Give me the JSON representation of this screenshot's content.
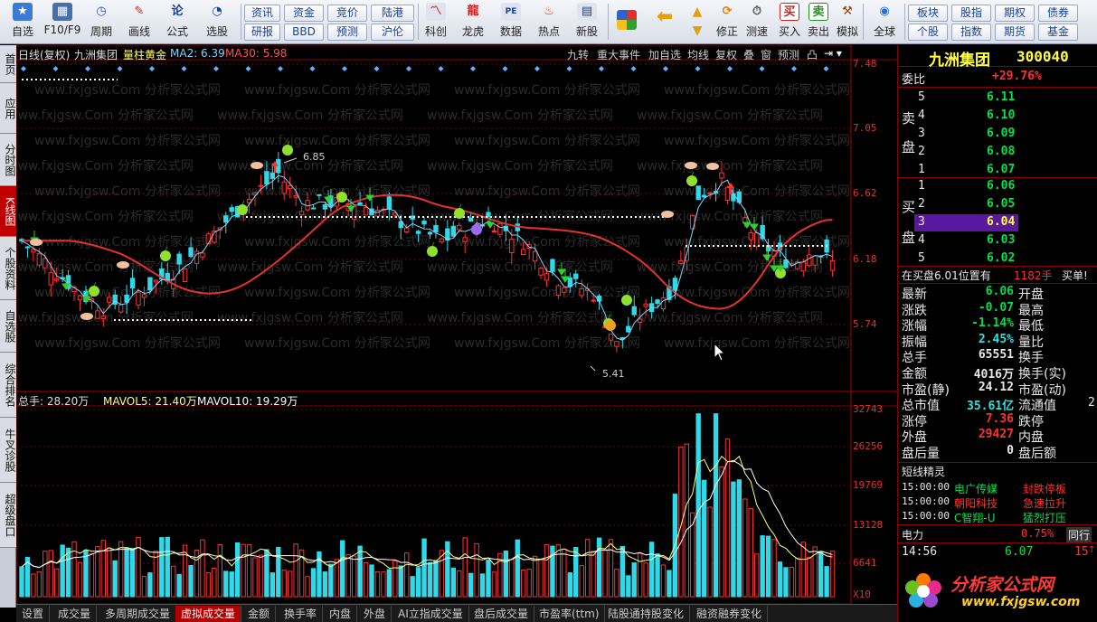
{
  "toolbar": {
    "buttons": [
      {
        "label": "自选",
        "icon": "star"
      },
      {
        "label": "F10/F9",
        "icon": "grid"
      },
      {
        "label": "周期",
        "icon": "clock"
      },
      {
        "label": "画线",
        "icon": "pencil"
      },
      {
        "label": "公式",
        "icon": "formula"
      },
      {
        "label": "选股",
        "icon": "chart"
      }
    ],
    "small_buttons": [
      {
        "label": "资讯"
      },
      {
        "label": "资金"
      },
      {
        "label": "竞价"
      },
      {
        "label": "陆港"
      },
      {
        "label": "研报"
      },
      {
        "label": "BBD"
      },
      {
        "label": "预测"
      },
      {
        "label": "沪伦"
      }
    ],
    "mid_buttons": [
      {
        "label": "科创"
      },
      {
        "label": "龙虎"
      },
      {
        "label": "数据"
      },
      {
        "label": "热点"
      },
      {
        "label": "新股"
      }
    ],
    "action_buttons": [
      {
        "label": "修正"
      },
      {
        "label": "测速"
      },
      {
        "label": "买入"
      },
      {
        "label": "卖出"
      },
      {
        "label": "模拟"
      },
      {
        "label": "全球"
      }
    ],
    "right_buttons": [
      {
        "label": "板块"
      },
      {
        "label": "股指"
      },
      {
        "label": "期权"
      },
      {
        "label": "债券"
      },
      {
        "label": "个股"
      },
      {
        "label": "指数"
      },
      {
        "label": "期货"
      },
      {
        "label": "基金"
      }
    ]
  },
  "left_tabs": [
    {
      "label": "首页"
    },
    {
      "label": "应用"
    },
    {
      "label": "分时图"
    },
    {
      "label": "K线图"
    },
    {
      "label": "个股资料"
    },
    {
      "label": "自选股"
    },
    {
      "label": "综合排名"
    },
    {
      "label": "牛叉诊股"
    },
    {
      "label": "超级盘口"
    }
  ],
  "chart_header": {
    "period": "日线(复权)",
    "stock": "九洲集团",
    "indicator": "量柱黄金",
    "ma2": "MA2: 6.39",
    "ma30": "MA30: 5.98",
    "menu": [
      "九转",
      "重大事件",
      "加自选",
      "均线",
      "复权",
      "叠",
      "窗",
      "预测",
      "凸"
    ],
    "watermark": "www.fxjgsw.Com 分析家公式网"
  },
  "price_axis": [
    "7.48",
    "7.05",
    "6.62",
    "6.18",
    "5.74"
  ],
  "high_label": "6.85",
  "low_label": "5.41",
  "volume_header": {
    "total": "总手: 28.20万",
    "mavol5": "MAVOL5: 21.40万",
    "mavol10": "MAVOL10: 19.29万"
  },
  "volume_axis": [
    "32743",
    "26256",
    "19769",
    "13128",
    "6641",
    "X10"
  ],
  "bottom_tabs": [
    {
      "label": "设置"
    },
    {
      "label": "成交量"
    },
    {
      "label": "多周期成交量"
    },
    {
      "label": "虚拟成交量"
    },
    {
      "label": "金额"
    },
    {
      "label": "换手率"
    },
    {
      "label": "内盘"
    },
    {
      "label": "外盘"
    },
    {
      "label": "AI立指成交量"
    },
    {
      "label": "盘后成交量"
    },
    {
      "label": "市盈率(ttm)"
    },
    {
      "label": "陆股通持股变化"
    },
    {
      "label": "融资融券变化"
    }
  ],
  "quote": {
    "name": "九洲集团",
    "code": "300040",
    "weibi_label": "委比",
    "weibi_value": "+29.76%",
    "sell_label": [
      "卖",
      "盘"
    ],
    "buy_label": [
      "买",
      "盘"
    ],
    "sell": [
      {
        "level": "5",
        "price": "6.11"
      },
      {
        "level": "4",
        "price": "6.10"
      },
      {
        "level": "3",
        "price": "6.09"
      },
      {
        "level": "2",
        "price": "6.08"
      },
      {
        "level": "1",
        "price": "6.07"
      }
    ],
    "buy": [
      {
        "level": "1",
        "price": "6.06"
      },
      {
        "level": "2",
        "price": "6.05"
      },
      {
        "level": "3",
        "price": "6.04"
      },
      {
        "level": "4",
        "price": "6.03"
      },
      {
        "level": "5",
        "price": "6.02"
      }
    ],
    "order_note": "在买盘6.01位置有",
    "order_qty": "1182手",
    "order_type": "买单!",
    "stats": [
      {
        "l1": "最新",
        "v1": "6.06",
        "l2": "开盘",
        "v2": ""
      },
      {
        "l1": "涨跌",
        "v1": "-0.07",
        "l2": "最高",
        "v2": ""
      },
      {
        "l1": "涨幅",
        "v1": "-1.14%",
        "l2": "最低",
        "v2": ""
      },
      {
        "l1": "振幅",
        "v1": "2.45%",
        "l2": "量比",
        "v2": ""
      },
      {
        "l1": "总手",
        "v1": "65551",
        "l2": "换手",
        "v2": ""
      },
      {
        "l1": "金额",
        "v1": "4016万",
        "l2": "换手(实)",
        "v2": ""
      },
      {
        "l1": "市盈(静)",
        "v1": "24.12",
        "l2": "市盈(动)",
        "v2": ""
      },
      {
        "l1": "总市值",
        "v1": "35.61亿",
        "l2": "流通值",
        "v2": "2"
      },
      {
        "l1": "涨停",
        "v1": "7.36",
        "l2": "跌停",
        "v2": ""
      },
      {
        "l1": "外盘",
        "v1": "29427",
        "l2": "内盘",
        "v2": ""
      },
      {
        "l1": "盘后量",
        "v1": "0",
        "l2": "盘后额",
        "v2": ""
      }
    ],
    "sprite_title": "短线精灵",
    "sprite_items": [
      {
        "time": "15:00:00",
        "name": "电广传媒",
        "event": "封跌停板"
      },
      {
        "time": "15:00:00",
        "name": "朝阳科技",
        "event": "急速拉升"
      },
      {
        "time": "15:00:00",
        "name": "C智翔-U",
        "event": "猛烈打压"
      }
    ],
    "sector_name": "电力",
    "sector_change": "0.75%",
    "sector_tab": "同行",
    "tick_time": "14:56",
    "tick_price": "6.07",
    "tick_qty": "15"
  },
  "logo": {
    "name": "分析家公式网",
    "url": "www.fxjgsw.com"
  },
  "colors": {
    "up": "#ff3030",
    "down": "#30d8e8",
    "ma30": "#e83030",
    "ma2": "#7fd4ff",
    "vol5": "#ffff80",
    "vol10": "#ffffff"
  }
}
